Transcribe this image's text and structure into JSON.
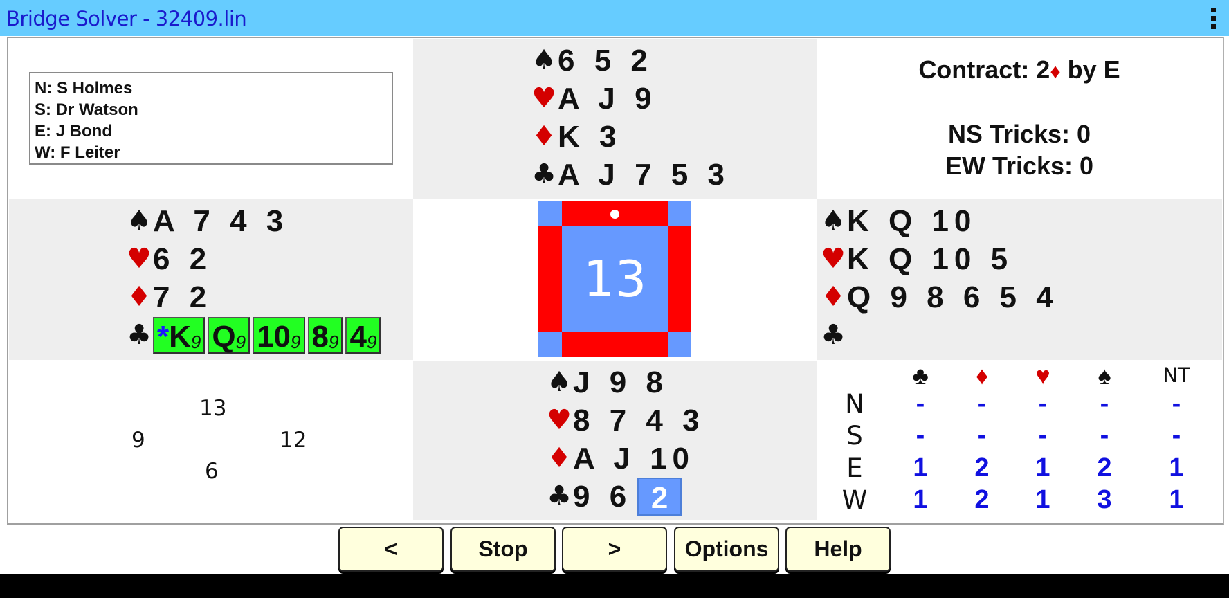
{
  "app": {
    "title": "Bridge Solver - 32409.lin",
    "menu_icon": "overflow-menu-icon"
  },
  "players": {
    "lines": [
      "N: S Holmes",
      "S: Dr Watson",
      "E: J Bond",
      "W: F Leiter"
    ]
  },
  "suits": {
    "spade": "♠",
    "heart": "♥",
    "diamond": "♦",
    "club": "♣"
  },
  "colors": {
    "title_bar": "#66ccff",
    "panel_bg": "#eeeeee",
    "compass_blue": "#6699ff",
    "compass_red": "#ff0000",
    "playable_card": "#22ff22",
    "played_card": "#6699ff",
    "red_suit": "#d40000",
    "table_value": "#1010e0",
    "button_bg": "#ffffdd"
  },
  "hands": {
    "north": {
      "spades": "6 5 2",
      "hearts": "A J 9",
      "diamonds": "K 3",
      "clubs": "A J 7 5 3"
    },
    "west": {
      "spades": "A 7 4 3",
      "hearts": "6 2",
      "diamonds": "7 2",
      "clubs_buttons": [
        {
          "star": "*",
          "rank": "K",
          "score": "9"
        },
        {
          "star": "",
          "rank": "Q",
          "score": "9"
        },
        {
          "star": "",
          "rank": "10",
          "score": "9"
        },
        {
          "star": "",
          "rank": "8",
          "score": "9"
        },
        {
          "star": "",
          "rank": "4",
          "score": "9"
        }
      ]
    },
    "east": {
      "spades": "K Q 10",
      "hearts": "K Q 10 5",
      "diamonds": "Q 9 8 6 5 4",
      "clubs": ""
    },
    "south": {
      "spades": "J 9 8",
      "hearts": "8 7 4 3",
      "diamonds": "A J 10",
      "clubs": "9 6",
      "played_card": "2"
    }
  },
  "compass": {
    "tricks_remaining": "13",
    "turn_indicator": "north"
  },
  "contract": {
    "label": "Contract: 2",
    "suit": "♦",
    "by": " by E"
  },
  "tricks": {
    "ns": "NS Tricks: 0",
    "ew": "EW Tricks: 0"
  },
  "hcp": {
    "north": "13",
    "west": "9",
    "east": "12",
    "south": "6"
  },
  "dd_table": {
    "headers": [
      {
        "symbol": "♣",
        "color": "black"
      },
      {
        "symbol": "♦",
        "color": "red"
      },
      {
        "symbol": "♥",
        "color": "red"
      },
      {
        "symbol": "♠",
        "color": "black"
      },
      {
        "symbol": "NT",
        "color": "black"
      }
    ],
    "rows": [
      {
        "label": "N",
        "values": [
          "-",
          "-",
          "-",
          "-",
          "-"
        ]
      },
      {
        "label": "S",
        "values": [
          "-",
          "-",
          "-",
          "-",
          "-"
        ]
      },
      {
        "label": "E",
        "values": [
          "1",
          "2",
          "1",
          "2",
          "1"
        ]
      },
      {
        "label": "W",
        "values": [
          "1",
          "2",
          "1",
          "3",
          "1"
        ]
      }
    ]
  },
  "buttons": {
    "prev": "<",
    "stop": "Stop",
    "next": ">",
    "options": "Options",
    "help": "Help"
  }
}
